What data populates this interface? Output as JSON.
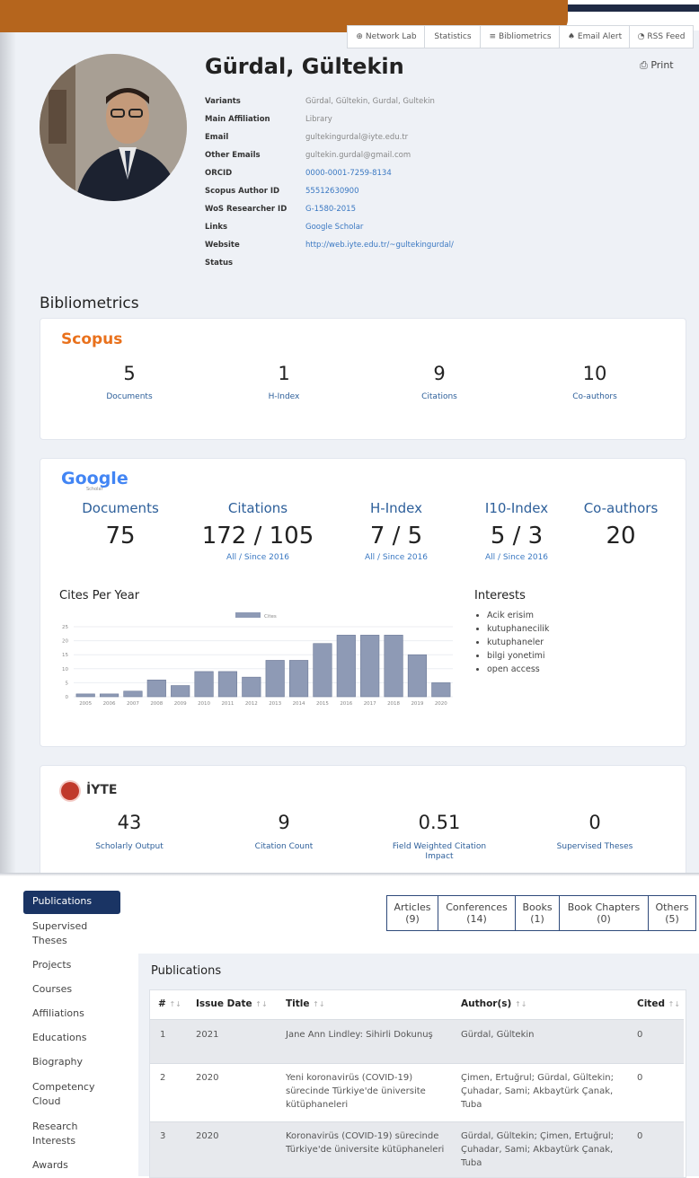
{
  "toolbar": {
    "buttons": [
      "Network Lab",
      "Statistics",
      "Bibliometrics",
      "Email Alert",
      "RSS Feed"
    ],
    "print": "Print"
  },
  "profile": {
    "name": "Gürdal, Gültekin",
    "fields": [
      {
        "label": "Variants",
        "value": "Gürdal, Gültekin, Gurdal, Gultekin",
        "link": false
      },
      {
        "label": "Main Affiliation",
        "value": "Library",
        "link": false
      },
      {
        "label": "Email",
        "value": "gultekingurdal@iyte.edu.tr",
        "link": false
      },
      {
        "label": "Other Emails",
        "value": "gultekin.gurdal@gmail.com",
        "link": false
      },
      {
        "label": "ORCID",
        "value": "0000-0001-7259-8134",
        "link": true
      },
      {
        "label": "Scopus Author ID",
        "value": "55512630900",
        "link": true
      },
      {
        "label": "WoS Researcher ID",
        "value": "G-1580-2015",
        "link": true
      },
      {
        "label": "Links",
        "value": "Google Scholar",
        "link": true
      },
      {
        "label": "Website",
        "value": "http://web.iyte.edu.tr/~gultekingurdal/",
        "link": true
      },
      {
        "label": "Status",
        "value": "",
        "link": false
      }
    ]
  },
  "bibliometrics": {
    "heading": "Bibliometrics",
    "scopus": {
      "logo": "Scopus",
      "stats": [
        {
          "value": "5",
          "label": "Documents"
        },
        {
          "value": "1",
          "label": "H-Index"
        },
        {
          "value": "9",
          "label": "Citations"
        },
        {
          "value": "10",
          "label": "Co-authors"
        }
      ]
    },
    "google": {
      "logo": "Google",
      "logo_sub": "Scholar",
      "stats": [
        {
          "title": "Documents",
          "value": "75",
          "sub": ""
        },
        {
          "title": "Citations",
          "value": "172 / 105",
          "sub": "All / Since 2016"
        },
        {
          "title": "H-Index",
          "value": "7 / 5",
          "sub": "All / Since 2016"
        },
        {
          "title": "I10-Index",
          "value": "5 / 3",
          "sub": "All / Since 2016"
        },
        {
          "title": "Co-authors",
          "value": "20",
          "sub": ""
        }
      ],
      "cites_heading": "Cites Per Year",
      "interests_heading": "Interests",
      "interests": [
        "Acik erisim",
        "kutuphanecilik",
        "kutuphaneler",
        "bilgi yonetimi",
        "open access"
      ]
    },
    "iyte": {
      "logo": "İYTE",
      "stats": [
        {
          "value": "43",
          "label": "Scholarly Output"
        },
        {
          "value": "9",
          "label": "Citation Count"
        },
        {
          "value": "0.51",
          "label": "Field Weighted Citation Impact"
        },
        {
          "value": "0",
          "label": "Supervised Theses"
        }
      ]
    }
  },
  "chart_data": {
    "type": "bar",
    "categories": [
      "2005",
      "2006",
      "2007",
      "2008",
      "2009",
      "2010",
      "2011",
      "2012",
      "2013",
      "2014",
      "2015",
      "2016",
      "2017",
      "2018",
      "2019",
      "2020"
    ],
    "series": [
      {
        "name": "Cites",
        "values": [
          1,
          1,
          2,
          6,
          4,
          9,
          9,
          7,
          13,
          13,
          19,
          22,
          22,
          22,
          15,
          5
        ]
      }
    ],
    "ylim": [
      0,
      25
    ],
    "yticks": [
      "0",
      "5",
      "10",
      "15",
      "20",
      "25"
    ],
    "color": "#8e9ab5",
    "legend": "top"
  },
  "sidebar": {
    "items": [
      "Publications",
      "Supervised Theses",
      "Projects",
      "Courses",
      "Affiliations",
      "Educations",
      "Biography",
      "Competency Cloud",
      "Research Interests",
      "Awards"
    ]
  },
  "category_tabs": [
    {
      "name": "Articles",
      "count": "(9)"
    },
    {
      "name": "Conferences",
      "count": "(14)"
    },
    {
      "name": "Books",
      "count": "(1)"
    },
    {
      "name": "Book Chapters",
      "count": "(0)"
    },
    {
      "name": "Others",
      "count": "(5)"
    }
  ],
  "publications": {
    "heading": "Publications",
    "columns": [
      "#",
      "Issue Date",
      "Title",
      "Author(s)",
      "Cited"
    ],
    "rows": [
      {
        "num": "1",
        "date": "2021",
        "title": "Jane Ann Lindley: Sihirli Dokunuş",
        "authors": "Gürdal, Gültekin",
        "cited": "0"
      },
      {
        "num": "2",
        "date": "2020",
        "title": "Yeni koronavirüs (COVID-19) sürecinde Türkiye'de üniversite kütüphaneleri",
        "authors": "Çimen, Ertuğrul; Gürdal, Gültekin; Çuhadar, Sami; Akbaytürk Çanak, Tuba",
        "cited": "0"
      },
      {
        "num": "3",
        "date": "2020",
        "title": "Koronavirüs (COVID-19) sürecinde Türkiye'de üniversite kütüphaneleri",
        "authors": "Gürdal, Gültekin; Çimen, Ertuğrul; Çuhadar, Sami; Akbaytürk Çanak, Tuba",
        "cited": "0"
      }
    ]
  }
}
